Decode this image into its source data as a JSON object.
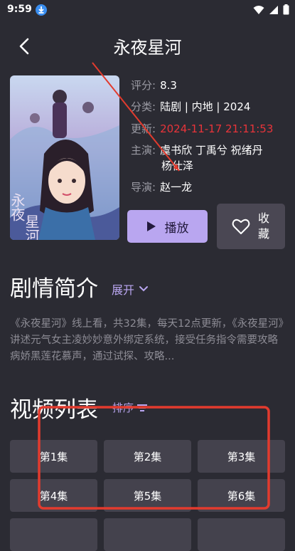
{
  "status": {
    "time": "9:59"
  },
  "header": {
    "title": "永夜星河"
  },
  "info": {
    "rating_label": "评分:",
    "rating": "8.3",
    "category_label": "分类:",
    "category": "陆剧 | 内地 | 2024",
    "updated_label": "更新:",
    "updated": "2024-11-17 21:11:53",
    "cast_label": "主演:",
    "cast_line1": "虞书欣 丁禹兮 祝绪丹",
    "cast_line2": "杨仕泽",
    "director_label": "导演:",
    "director": "赵一龙"
  },
  "actions": {
    "play_label": "播放",
    "fav_label": "收藏"
  },
  "synopsis": {
    "title": "剧情简介",
    "expand_label": "展开",
    "text": "《永夜星河》线上看，共32集，每天12点更新，《永夜星河》讲述元气女主凌妙妙意外绑定系统，接受任务指令需要攻略病娇黑莲花慕声，通过试探、攻略..."
  },
  "episodes": {
    "title": "视频列表",
    "sort_label": "排序",
    "items": [
      "第1集",
      "第2集",
      "第3集",
      "第4集",
      "第5集",
      "第6集"
    ]
  },
  "colors": {
    "background": "#2b2b33",
    "accent": "#b9a6f0",
    "date_red": "#e8343a",
    "annotation_red": "#e23b2e"
  }
}
